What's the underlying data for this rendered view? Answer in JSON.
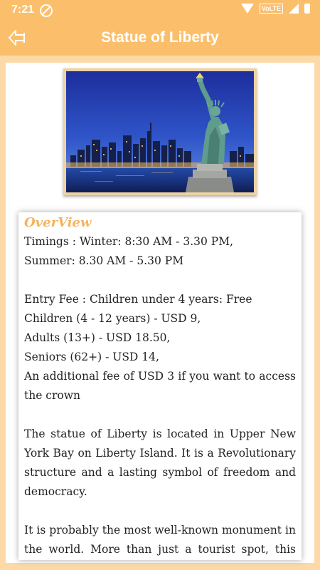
{
  "status_bar": {
    "time": "7:21",
    "network_label": "VoLTE",
    "icons": [
      "do-not-disturb-icon",
      "wifi-icon",
      "volte-icon",
      "signal-icon",
      "battery-icon"
    ]
  },
  "app_bar": {
    "title": "Statue of Liberty",
    "back_icon": "back-arrow-icon",
    "color": "#fbbf6c"
  },
  "overview": {
    "heading": "OverView",
    "heading_color": "#f6b35d",
    "lines": {
      "timings_1": "Timings : Winter: 8:30 AM - 3.30 PM,",
      "timings_2": "Summer: 8.30 AM - 5.30 PM",
      "fee_1": "Entry Fee : Children under 4 years: Free",
      "fee_2": "Children (4 - 12 years) - USD 9,",
      "fee_3": "Adults (13+) - USD 18.50,",
      "fee_4": "Seniors (62+) - USD 14,",
      "fee_5": "An additional fee of USD 3 if you want to access the crown",
      "para_1": "The statue of Liberty is located in Upper New York Bay on Liberty Island. It is a Revolutionary structure and a lasting symbol of freedom and democracy.",
      "para_2": "It is probably the most well-known monument in the world. More than just a tourist spot, this iconic symbol is a welcoming beacon to immigrants who"
    }
  },
  "colors": {
    "background": "#fcd9a6",
    "frame": "#ecd2a4"
  }
}
